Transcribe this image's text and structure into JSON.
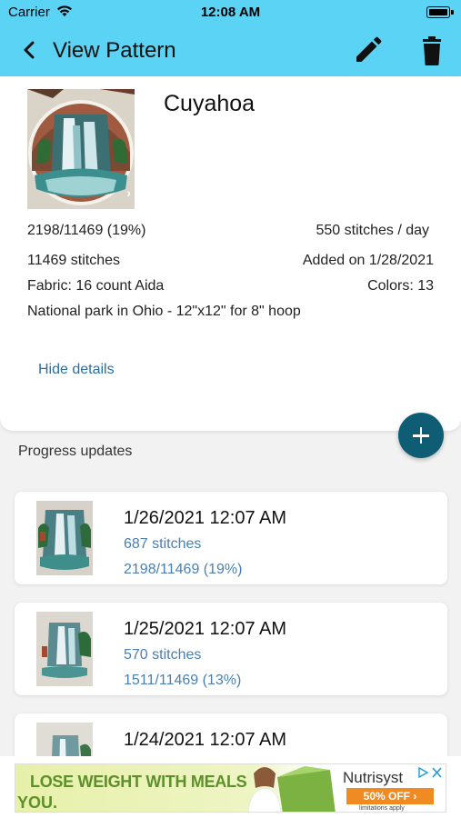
{
  "status_bar": {
    "carrier": "Carrier",
    "time": "12:08 AM"
  },
  "nav": {
    "title": "View Pattern",
    "back_icon": "chevron-left-icon",
    "edit_icon": "pencil-icon",
    "delete_icon": "trash-icon"
  },
  "pattern": {
    "name": "Cuyahoa",
    "progress": "2198/11469 (19%)",
    "per_day": "550 stitches / day",
    "total_stitches": "11469 stitches",
    "added_on": "Added on 1/28/2021",
    "fabric": "Fabric: 16 count Aida",
    "colors": "Colors: 13",
    "description": "National park in Ohio - 12\"x12\" for 8\" hoop",
    "hide_details": "Hide details",
    "image_chevron": "›"
  },
  "section_title": "Progress updates",
  "updates": [
    {
      "date": "1/26/2021 12:07 AM",
      "stitches": "687 stitches",
      "progress": "2198/11469 (19%)"
    },
    {
      "date": "1/25/2021 12:07 AM",
      "stitches": "570 stitches",
      "progress": "1511/11469 (13%)"
    },
    {
      "date": "1/24/2021 12:07 AM",
      "stitches": "",
      "progress": ""
    }
  ],
  "ad": {
    "headline_line1": "LOSE WEIGHT WITH MEALS",
    "headline_line2": "YOU.",
    "brand": "Nutrisyst",
    "offer": "50% OFF ›",
    "fine_print": "limitations apply"
  },
  "colors": {
    "nav_bar": "#5ad3f5",
    "accent_link": "#2a6fa0",
    "fab": "#0e5d75",
    "update_text": "#4a7fb2"
  }
}
